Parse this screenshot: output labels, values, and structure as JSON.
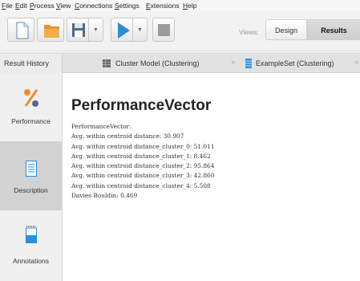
{
  "menu": [
    {
      "name": "menu-file",
      "first": "F",
      "rest": "ile"
    },
    {
      "name": "menu-edit",
      "first": "E",
      "rest": "dit"
    },
    {
      "name": "menu-process",
      "first": "P",
      "rest": "rocess"
    },
    {
      "name": "menu-view",
      "first": "V",
      "rest": "iew"
    },
    {
      "name": "menu-connections",
      "first": "C",
      "rest": "onnections"
    },
    {
      "name": "menu-settings",
      "first": "S",
      "rest": "ettings"
    },
    {
      "name": "menu-extensions",
      "first": "E",
      "rest": "xtensions"
    },
    {
      "name": "menu-help",
      "first": "H",
      "rest": "elp"
    }
  ],
  "toolbar": {
    "icons": {
      "new": "new-file-icon",
      "open": "open-folder-icon",
      "save": "save-icon",
      "run": "run-play-icon",
      "stop": "stop-icon"
    },
    "views_label": "Views:",
    "views": {
      "design": "Design",
      "results": "Results"
    }
  },
  "tabs": {
    "result_history": "Result History",
    "cluster_model": "Cluster Model (Clustering)",
    "example_set": "ExampleSet (Clustering)",
    "close_glyph": "×"
  },
  "sidebar": {
    "performance": {
      "label": "Performance",
      "icon": "percent-icon"
    },
    "description": {
      "label": "Description",
      "icon": "document-icon"
    },
    "annotations": {
      "label": "Annotations",
      "icon": "notepad-icon"
    }
  },
  "main": {
    "title": "PerformanceVector",
    "lines": [
      "PerformanceVector:",
      "Avg. within centroid distance: 30.907",
      "Avg. within centroid distance_cluster_0: 51.011",
      "Avg. within centroid distance_cluster_1: 8.462",
      "Avg. within centroid distance_cluster_2: 95.864",
      "Avg. within centroid distance_cluster_3: 42.860",
      "Avg. within centroid distance_cluster_4: 5.508",
      "Davies Bouldin: 0.469"
    ]
  },
  "colors": {
    "accent_orange": "#e8912d",
    "run_blue": "#2a8fd8",
    "selected_panel": "#d2d2d2"
  }
}
